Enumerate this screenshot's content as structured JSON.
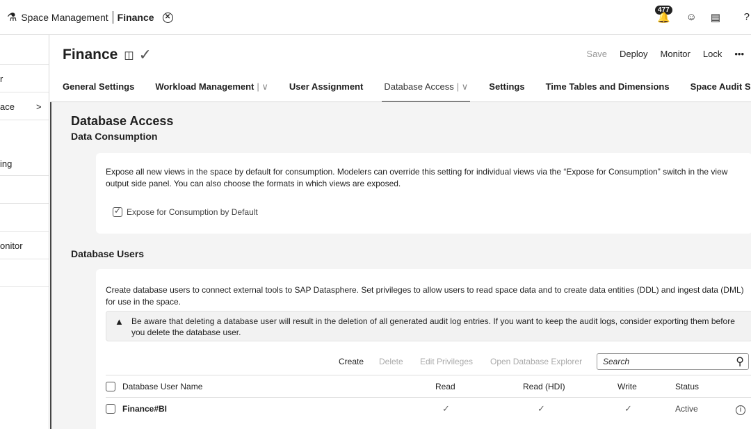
{
  "shell": {
    "app_icon": "space-management-icon",
    "app_title": "Space Management",
    "space_name": "Finance",
    "notification_count": "477"
  },
  "sidebar": {
    "items": [
      "r",
      "ace",
      "ing",
      "onitor"
    ]
  },
  "header": {
    "title": "Finance",
    "actions": {
      "save": "Save",
      "deploy": "Deploy",
      "monitor": "Monitor",
      "lock": "Lock",
      "more": "•••"
    }
  },
  "tabs": [
    {
      "label": "General Settings"
    },
    {
      "label": "Workload Management"
    },
    {
      "label": "User Assignment"
    },
    {
      "label": "Database Access"
    },
    {
      "label": "Settings"
    },
    {
      "label": "Time Tables and Dimensions"
    },
    {
      "label": "Space Audit Se"
    }
  ],
  "database_access": {
    "title": "Database Access",
    "subtitle": "Data Consumption",
    "description": "Expose all new views in the space by default for consumption. Modelers can override this setting for individual views via the “Expose for Consumption” switch in the view output side panel. You can also choose the formats in which views are exposed.",
    "expose_label": "Expose for Consumption by Default",
    "expose_checked": true
  },
  "database_users": {
    "title": "Database Users",
    "description": "Create database users to connect external tools to SAP Datasphere. Set privileges to allow users to read space data and to create data entities (DDL) and ingest data (DML) for use in the space.",
    "warning": "Be aware that deleting a database user will result in the deletion of all generated audit log entries. If you want to keep the audit logs, consider exporting them before you delete the database user.",
    "toolbar": {
      "create": "Create",
      "delete": "Delete",
      "edit_privileges": "Edit Privileges",
      "open_explorer": "Open Database Explorer",
      "search_placeholder": "Search"
    },
    "columns": {
      "name": "Database User Name",
      "read": "Read",
      "read_hdi": "Read (HDI)",
      "write": "Write",
      "status": "Status"
    },
    "rows": [
      {
        "name": "Finance#BI",
        "read": "✓",
        "read_hdi": "✓",
        "write": "✓",
        "status": "Active"
      }
    ]
  }
}
